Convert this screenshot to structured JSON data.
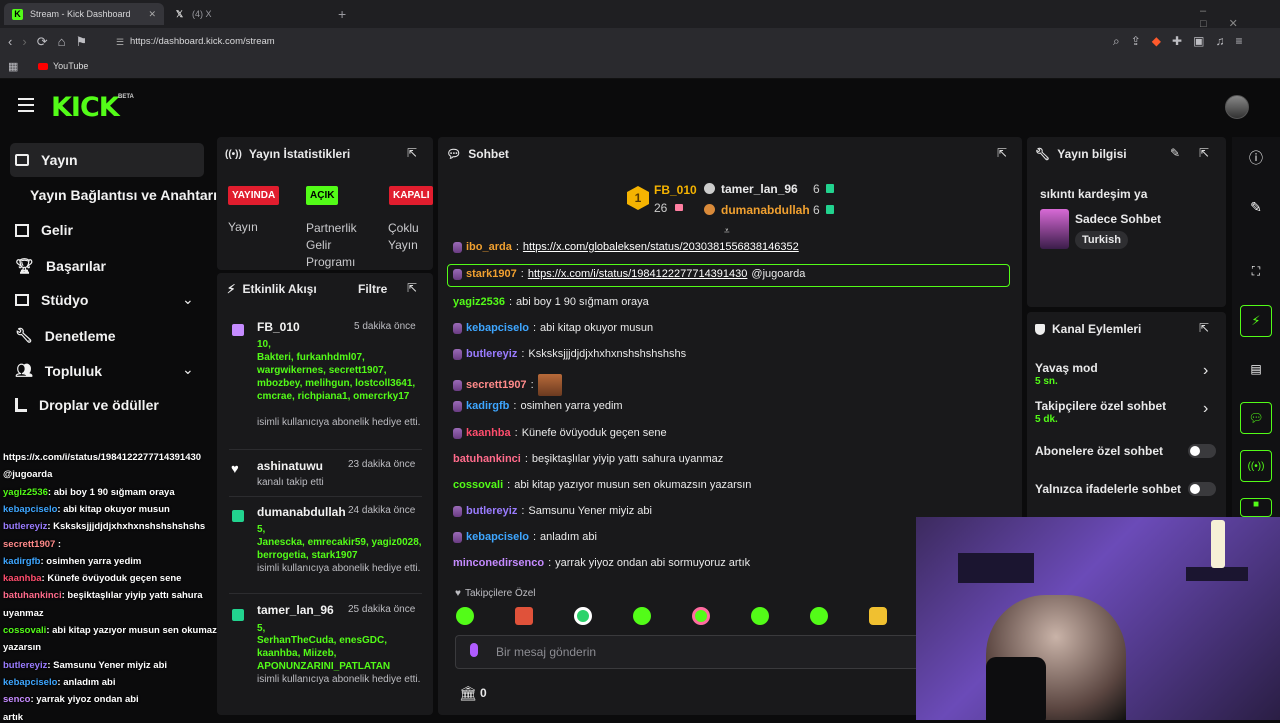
{
  "browser": {
    "tabs": [
      {
        "label": "Stream - Kick Dashboard",
        "favicon": "kick-icon"
      },
      {
        "label": "(4) X",
        "favicon": "x-icon"
      }
    ],
    "url": "https://dashboard.kick.com/stream",
    "bookmark": "YouTube"
  },
  "kick": {
    "logo": "KICK",
    "beta": "BETA"
  },
  "sidebar": {
    "items": [
      "Yayın",
      "Yayın Bağlantısı ve Anahtarı",
      "Gelir",
      "Başarılar",
      "Stüdyo",
      "Denetleme",
      "Topluluk",
      "Droplar ve ödüller"
    ]
  },
  "stats": {
    "title": "Yayın İstatistikleri",
    "badges": [
      "YAYINDA",
      "AÇIK",
      "KAPALI"
    ],
    "labels": [
      "Yayın",
      "Partnerlik Gelir Programı",
      "Çoklu Yayın"
    ]
  },
  "activity": {
    "title": "Etkinlik Akışı",
    "filter": "Filtre",
    "items": [
      {
        "name": "FB_010",
        "time": "5 dakika önce",
        "count": "10,",
        "users": "Bakteri, furkanhdml07, wargwikernes, secrett1907, mbozbey, melihgun, lostcoll3641, cmcrae, richpiana1, omercrky17",
        "note": "isimli kullanıcıya abonelik hediye etti."
      },
      {
        "name": "ashinatuwu",
        "time": "23 dakika önce",
        "note": "kanalı takip etti"
      },
      {
        "name": "dumanabdullah",
        "time": "24 dakika önce",
        "count": "5,",
        "users": "Janescka, emrecakir59, yagiz0028, berrogetia, stark1907",
        "note": "isimli kullanıcıya abonelik hediye etti."
      },
      {
        "name": "tamer_lan_96",
        "time": "25 dakika önce",
        "count": "5,",
        "users": "SerhanTheCuda, enesGDC, kaanhba, Miizeb, APONUNZARINI_PATLATAN",
        "note": "isimli kullanıcıya abonelik hediye etti."
      }
    ]
  },
  "chat": {
    "title": "Sohbet",
    "leaders": [
      {
        "rank": "1",
        "name": "FB_010",
        "count": "26"
      },
      {
        "name": "tamer_lan_96",
        "count": "6"
      },
      {
        "name": "dumanabdullah",
        "count": "6"
      }
    ],
    "messages": [
      {
        "user": "ibo_arda",
        "text": "https://x.com/globaleksen/status/2030381556838146352",
        "color": "#f0a030"
      },
      {
        "user": "stark1907",
        "text": "https://x.com/i/status/1984122277714391430",
        "suffix": "@jugoarda",
        "color": "#f0a030"
      },
      {
        "user": "yagiz2536",
        "text": "abi boy 1 90 sığmam oraya",
        "color": "#53fc18"
      },
      {
        "user": "kebapciselo",
        "text": "abi kitap okuyor musun",
        "color": "#3ea6ff"
      },
      {
        "user": "butlereyiz",
        "text": "Ksksksjjjdjdjxhxhxnshshshshshs",
        "color": "#9a7cff"
      },
      {
        "user": "secrett1907",
        "text": "",
        "color": "#ff8a8a"
      },
      {
        "user": "kadirgfb",
        "text": "osimhen yarra yedim",
        "color": "#3ea6ff"
      },
      {
        "user": "kaanhba",
        "text": "Künefe övüyoduk geçen sene",
        "color": "#ff4d6d"
      },
      {
        "user": "batuhankinci",
        "text": "beşiktaşlılar yiyip yattı sahura uyanmaz",
        "color": "#ff6b8b"
      },
      {
        "user": "cossovali",
        "text": "abi kitap yazıyor musun sen okumazsın yazarsın",
        "color": "#53fc18"
      },
      {
        "user": "butlereyiz",
        "text": "Samsunu Yener miyiz abi",
        "color": "#9a7cff"
      },
      {
        "user": "kebapciselo",
        "text": "anladım abi",
        "color": "#3ea6ff"
      },
      {
        "user": "minconedirsenco",
        "text": "yarrak yiyoz ondan abi sormuyoruz artık",
        "color": "#c58bff"
      }
    ],
    "followers_only": "Takipçilere Özel",
    "placeholder": "Bir mesaj gönderin",
    "points": "0"
  },
  "info": {
    "title": "Yayın bilgisi",
    "stream_title": "sıkıntı kardeşim ya",
    "category": "Sadece Sohbet",
    "language": "Turkish"
  },
  "actions": {
    "title": "Kanal Eylemleri",
    "items": [
      {
        "label": "Yavaş mod",
        "value": "5 sn."
      },
      {
        "label": "Takipçilere özel sohbet",
        "value": "5 dk."
      },
      {
        "label": "Abonelere özel sohbet"
      },
      {
        "label": "Yalnızca ifadelerle sohbet"
      }
    ]
  },
  "overlay": {
    "lines": [
      {
        "user": "",
        "text": "https://x.com/i/status/1984122277714391430",
        "color": "#ffffff"
      },
      {
        "user": "",
        "text": "@jugoarda",
        "color": "#ffffff"
      },
      {
        "user": "yagiz2536",
        "text": ": abi boy 1 90 sığmam oraya",
        "color": "#53fc18"
      },
      {
        "user": "kebapciselo",
        "text": ": abi kitap okuyor musun",
        "color": "#3ea6ff"
      },
      {
        "user": "butlereyiz",
        "text": ": Ksksksjjjdjdjxhxhxnshshshshshs",
        "color": "#9a7cff"
      },
      {
        "user": "secrett1907",
        "text": " :",
        "color": "#ff8a8a"
      },
      {
        "user": "kadirgfb",
        "text": ": osimhen yarra yedim",
        "color": "#3ea6ff"
      },
      {
        "user": "kaanhba",
        "text": ": Künefe övüyoduk geçen sene",
        "color": "#ff4d6d"
      },
      {
        "user": "batuhankinci",
        "text": ": beşiktaşlılar yiyip yattı sahura",
        "color": "#ff6b8b"
      },
      {
        "user": "",
        "text": "uyanmaz",
        "color": "#ffffff"
      },
      {
        "user": "cossovali",
        "text": ": abi kitap yazıyor musun sen okumazsın",
        "color": "#53fc18"
      },
      {
        "user": "",
        "text": "yazarsın",
        "color": "#ffffff"
      },
      {
        "user": "butlereyiz",
        "text": ": Samsunu Yener miyiz abi",
        "color": "#9a7cff"
      },
      {
        "user": "kebapciselo",
        "text": ": anladım abi",
        "color": "#3ea6ff"
      },
      {
        "user": "senco",
        "text": ": yarrak yiyoz ondan abi",
        "color": "#c58bff"
      },
      {
        "user": "",
        "text": "artık",
        "color": "#ffffff"
      }
    ]
  }
}
